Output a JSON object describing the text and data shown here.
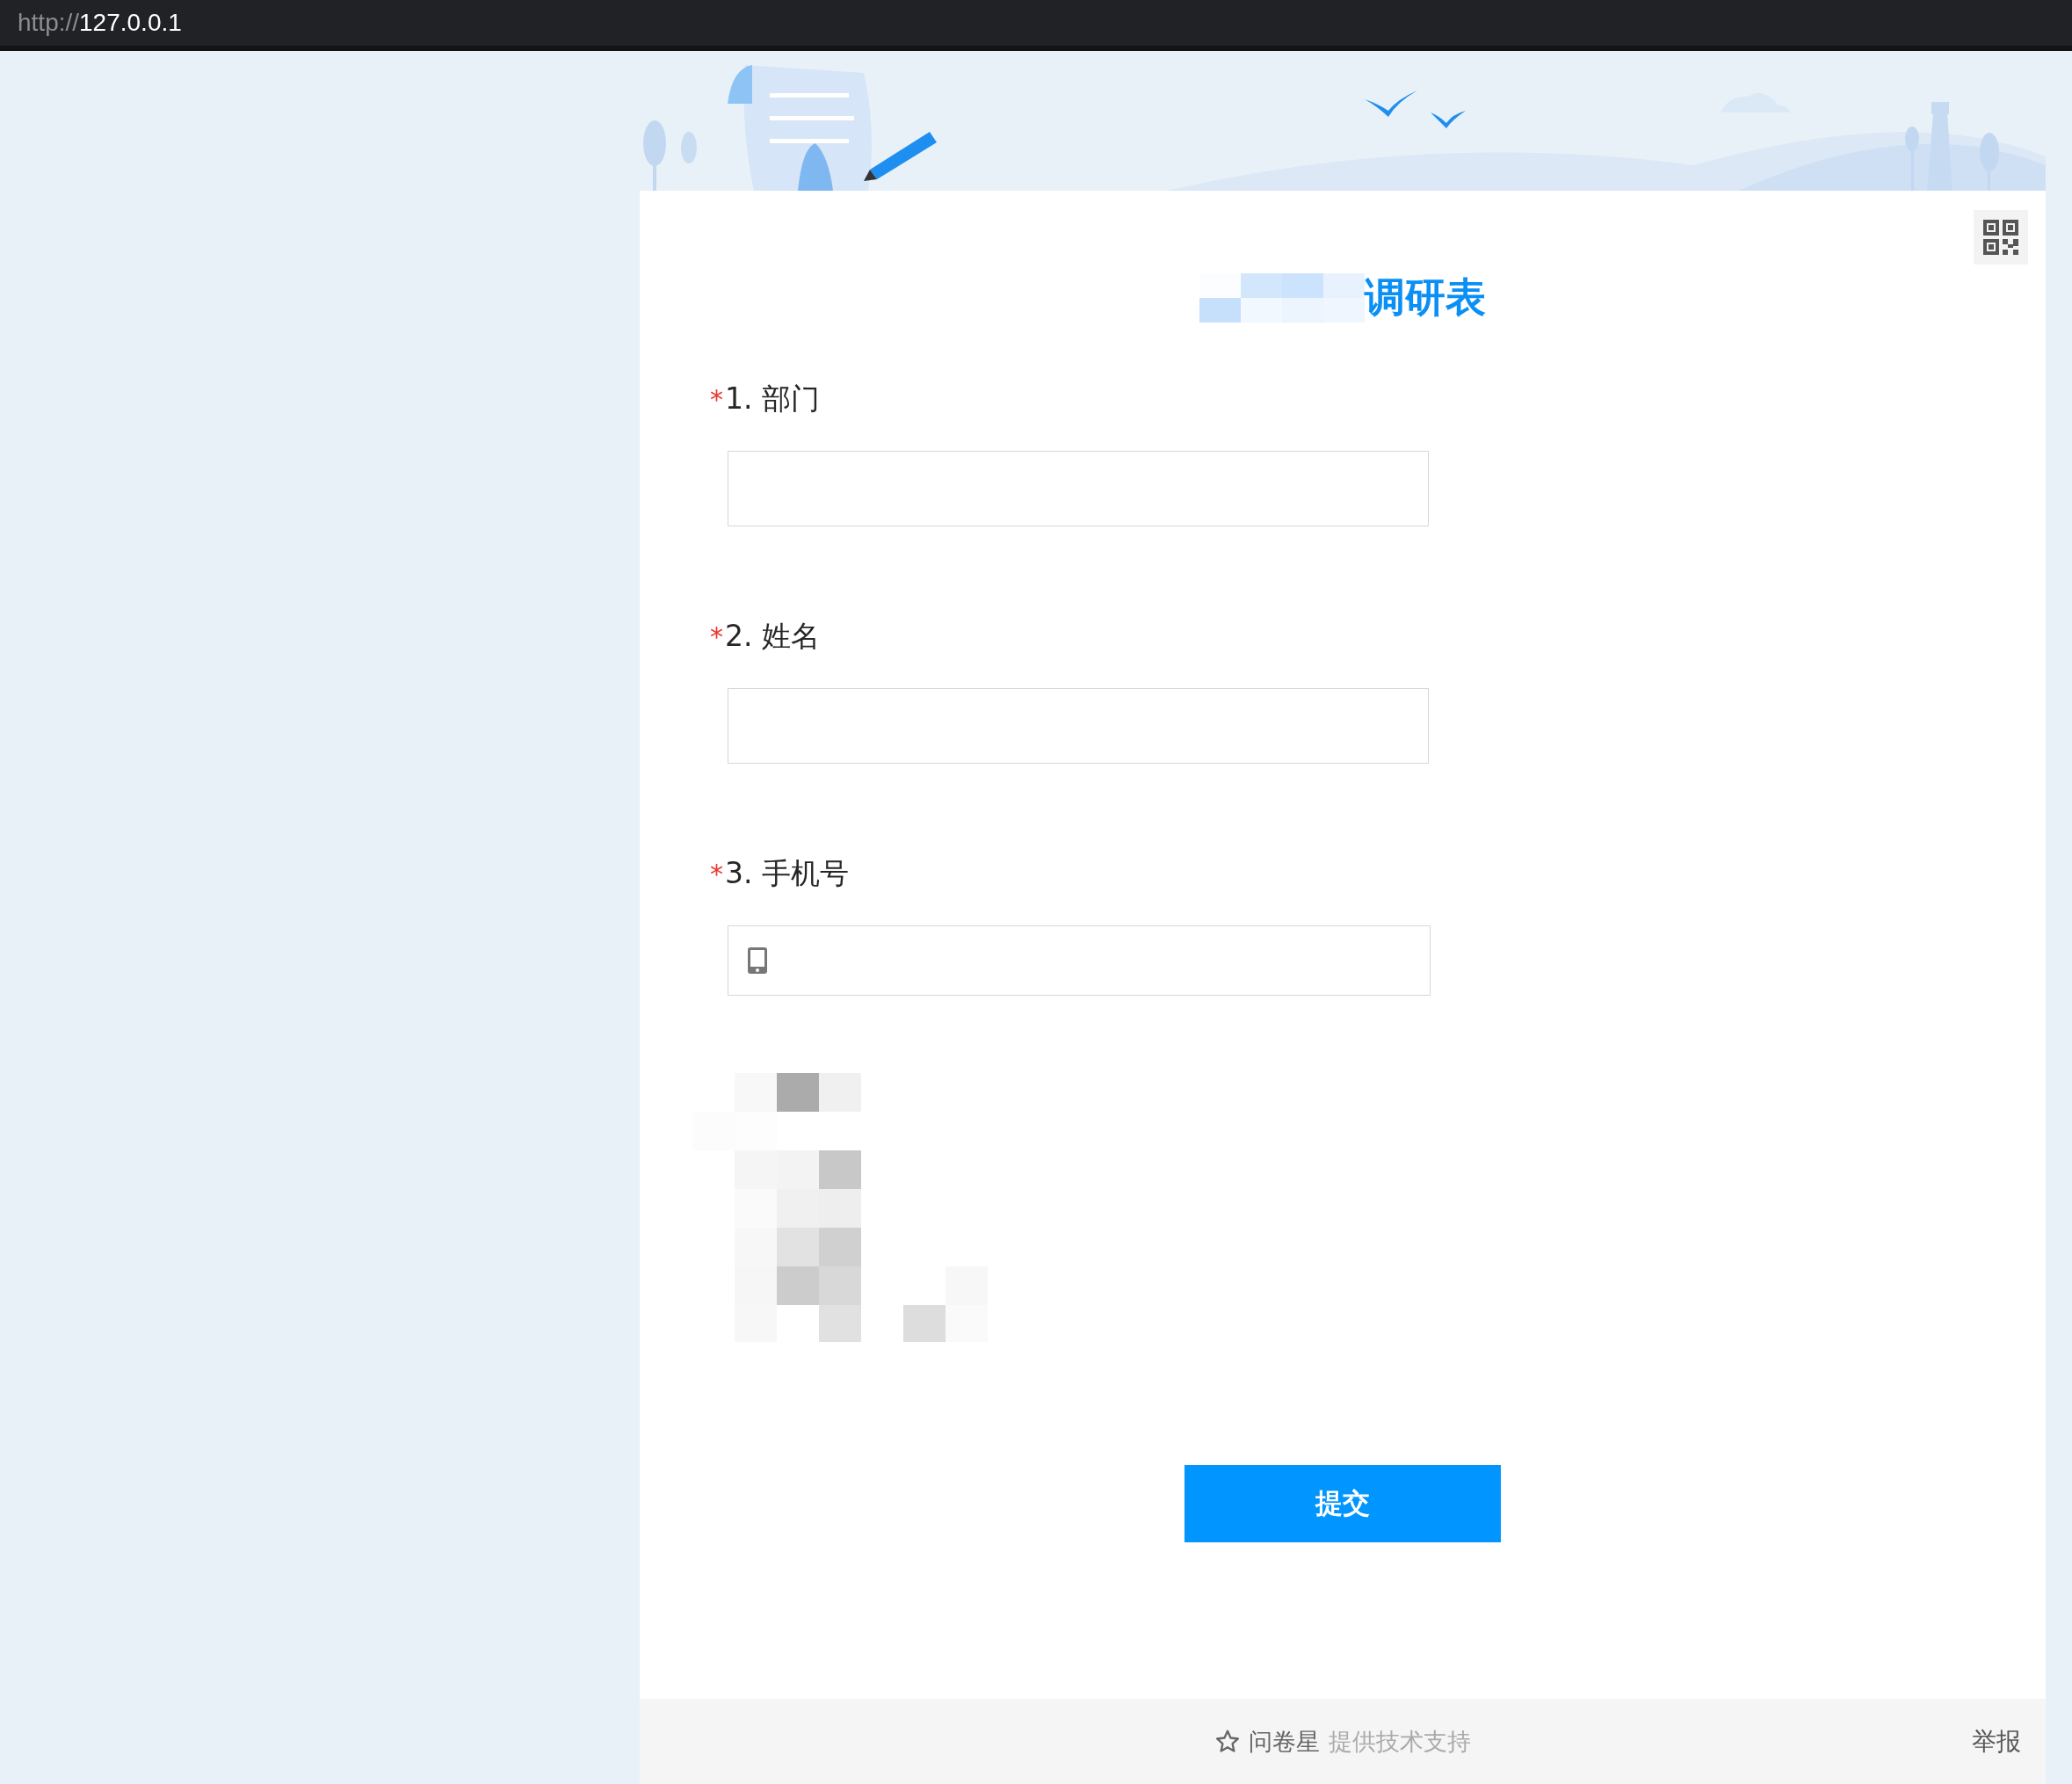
{
  "browser": {
    "url_scheme": "http://",
    "url_host": "127.0.0.1"
  },
  "survey": {
    "title": "调研表",
    "questions": [
      {
        "number": "1.",
        "label": "部门",
        "required": true,
        "required_mark": "*",
        "kind": "text"
      },
      {
        "number": "2.",
        "label": "姓名",
        "required": true,
        "required_mark": "*",
        "kind": "text"
      },
      {
        "number": "3.",
        "label": "手机号",
        "required": true,
        "required_mark": "*",
        "kind": "phone"
      }
    ],
    "submit": "提交"
  },
  "footer": {
    "brand": "问卷星",
    "credit": "提供技术支持",
    "report": "举报"
  }
}
